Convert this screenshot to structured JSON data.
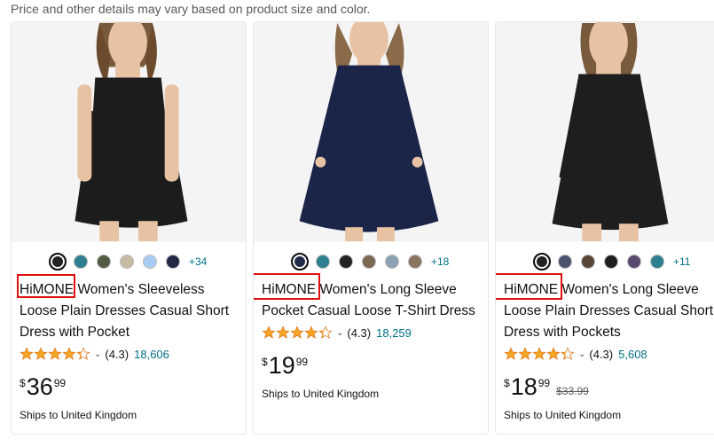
{
  "notice": "Price and other details may vary based on product size and color.",
  "products": [
    {
      "image_alt": "Black sleeveless dress",
      "swatches": [
        "#222222",
        "#2e7f8f",
        "#535b44",
        "#c8bba3",
        "#a9cdf2",
        "#242846"
      ],
      "selected_swatch": 0,
      "more_colors": "+34",
      "brand": "HiMONE",
      "title_rest": " Women's Sleeveless Loose Plain Dresses Casual Short Dress with Pocket",
      "rating": 4.3,
      "rating_text": "(4.3)",
      "review_count": "18,606",
      "currency": "$",
      "price_whole": "36",
      "price_fraction": "99",
      "was_price": "",
      "shipping": "Ships to United Kingdom",
      "dress_color": "#1c1c1c"
    },
    {
      "image_alt": "Navy long sleeve dress",
      "swatches": [
        "#202a4a",
        "#2e7f8f",
        "#222222",
        "#7d6a55",
        "#8fa2b5",
        "#8a7560"
      ],
      "selected_swatch": 0,
      "more_colors": "+18",
      "brand": "HiMONE",
      "title_rest": " Women's Long Sleeve Pocket Casual Loose T-Shirt Dress",
      "rating": 4.3,
      "rating_text": "(4.3)",
      "review_count": "18,259",
      "currency": "$",
      "price_whole": "19",
      "price_fraction": "99",
      "was_price": "",
      "shipping": "Ships to United Kingdom",
      "dress_color": "#1b2548"
    },
    {
      "image_alt": "Black long sleeve dress",
      "swatches": [
        "#222222",
        "#4a5270",
        "#5a4638",
        "#1f1f1f",
        "#5a4a72",
        "#2e7f8f"
      ],
      "selected_swatch": 0,
      "more_colors": "+11",
      "brand": "HiMONE",
      "title_rest": " Women's Long Sleeve Loose Plain Dresses Casual Short Dress with Pockets",
      "rating": 4.3,
      "rating_text": "(4.3)",
      "review_count": "5,608",
      "currency": "$",
      "price_whole": "18",
      "price_fraction": "99",
      "was_price": "$33.99",
      "shipping": "Ships to United Kingdom",
      "dress_color": "#1e1e1e"
    }
  ],
  "colors": {
    "link": "#007185",
    "star": "#f5a623",
    "highlight": "#e01010"
  }
}
